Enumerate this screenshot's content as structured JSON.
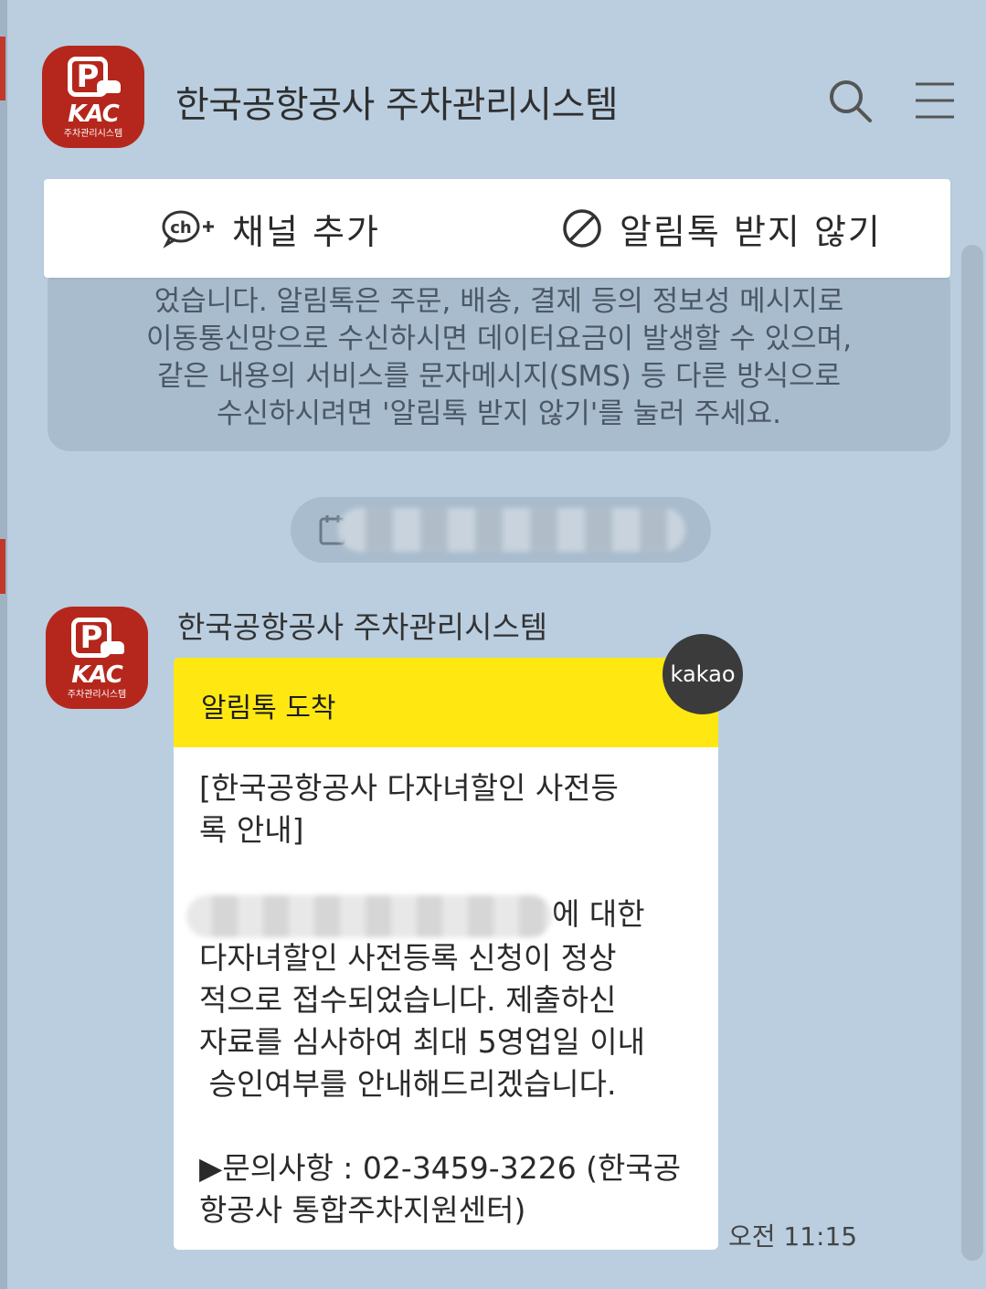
{
  "app": {
    "logo_kac": "KAC",
    "logo_sub": "주차관리시스템"
  },
  "header": {
    "title": "한국공항공사 주차관리시스템",
    "search_icon": "search-icon",
    "menu_icon": "menu-icon"
  },
  "actions": {
    "add_channel": "채널 추가",
    "block": "알림톡 받지 않기"
  },
  "notice": {
    "lines": [
      "었습니다. 알림톡은 주문, 배송, 결제 등의 정보성 메시지로",
      "이동통신망으로 수신하시면 데이터요금이 발생할 수 있으며,",
      "같은 내용의 서비스를 문자메시지(SMS) 등 다른 방식으로",
      "수신하시려면 '알림톡 받지 않기'를 눌러 주세요."
    ]
  },
  "message": {
    "sender": "한국공항공사 주차관리시스템",
    "badge": "kakao",
    "header": "알림톡 도착",
    "title_line1": "[한국공항공사 다자녀할인 사전등",
    "title_line2": "록 안내]",
    "body_line1_suffix": "에 대한",
    "body_line2": "다자녀할인 사전등록 신청이 정상",
    "body_line3": "적으로 접수되었습니다. 제출하신",
    "body_line4": "자료를 심사하여 최대 5영업일 이내",
    "body_line5": " 승인여부를 안내해드리겠습니다.",
    "contact_line1": "▶문의사항 : 02-3459-3226 (한국공",
    "contact_line2": "항공사 통합주차지원센터)",
    "time": "오전 11:15"
  },
  "colors": {
    "background": "#bacee0",
    "alimtalk_yellow": "#ffe812",
    "logo_red": "#b5271c"
  }
}
